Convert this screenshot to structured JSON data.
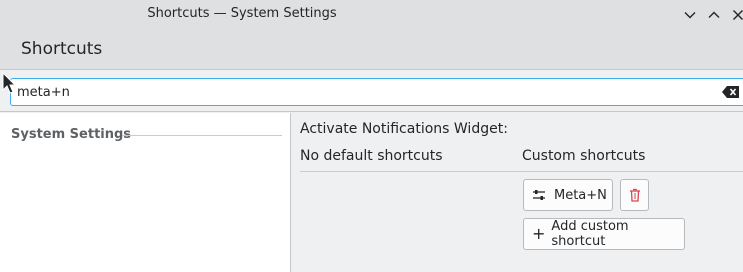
{
  "window": {
    "title": "Shortcuts — System Settings"
  },
  "header": {
    "title": "Shortcuts"
  },
  "search": {
    "value": "meta+n"
  },
  "sidebar": {
    "section": "System Settings"
  },
  "detail": {
    "action_title": "Activate Notifications Widget:",
    "default_column": "No default shortcuts",
    "custom_column": "Custom shortcuts",
    "shortcut_label": "Meta+N",
    "add_label": "Add custom shortcut"
  },
  "colors": {
    "accent": "#3daee9",
    "delete": "#da4453"
  }
}
